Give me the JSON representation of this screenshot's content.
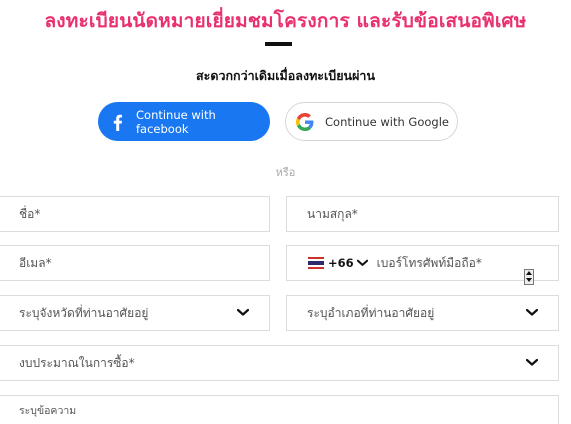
{
  "header": {
    "title": "ลงทะเบียนนัดหมายเยี่ยมชมโครงการ และรับข้อเสนอพิเศษ",
    "subtitle": "สะดวกกว่าเดิมเมื่อลงทะเบียนผ่าน"
  },
  "social": {
    "facebook_label": "Continue with facebook",
    "google_label": "Continue with Google",
    "divider_text": "หรือ"
  },
  "form": {
    "first_name_placeholder": "ชื่อ*",
    "last_name_placeholder": "นามสกุล*",
    "email_placeholder": "อีเมล*",
    "phone_country_code": "+66",
    "phone_placeholder": "เบอร์โทรศัพท์มือถือ*",
    "province_placeholder": "ระบุจังหวัดที่ท่านอาศัยอยู่",
    "district_placeholder": "ระบุอำเภอที่ท่านอาศัยอยู่",
    "budget_placeholder": "งบประมาณในการซื้อ*",
    "message_placeholder": "ระบุข้อความ"
  },
  "colors": {
    "title": "#e8316e",
    "facebook": "#1a77f2",
    "border": "#dcdcdc"
  },
  "icons": {
    "facebook": "facebook-icon",
    "google": "google-icon",
    "dropdown": "chevron-down-icon",
    "flag": "thailand-flag-icon"
  }
}
